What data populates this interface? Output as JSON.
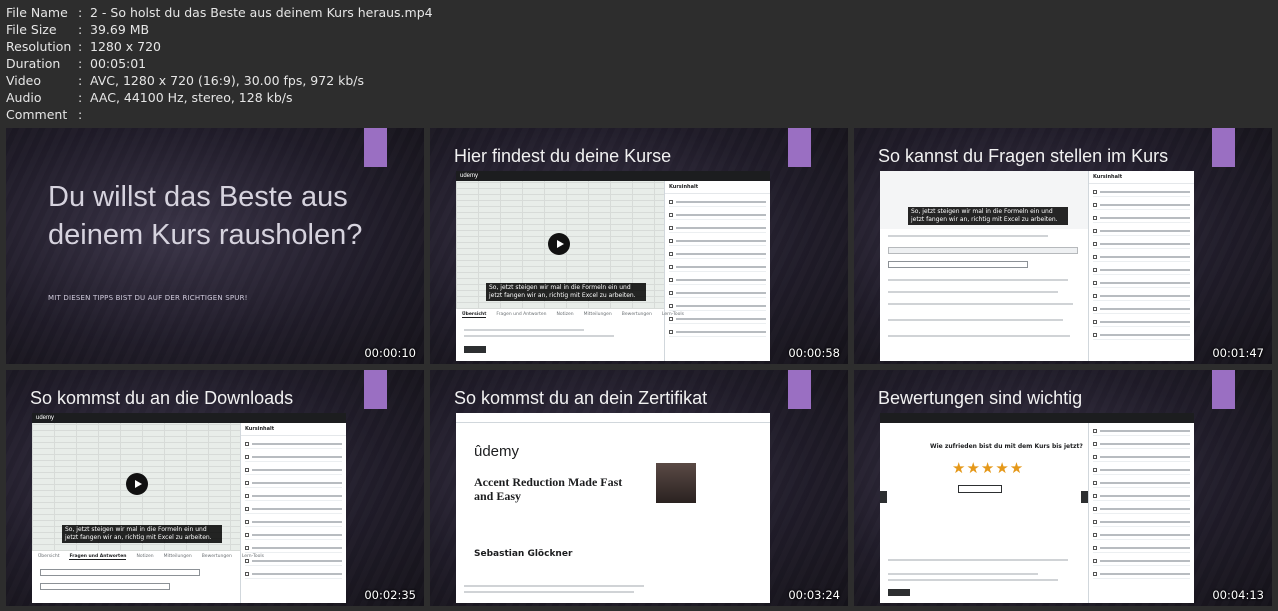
{
  "meta": {
    "rows": [
      {
        "key": "File Name",
        "value": "2 - So holst du das Beste aus deinem Kurs heraus.mp4"
      },
      {
        "key": "File Size",
        "value": "39.69 MB"
      },
      {
        "key": "Resolution",
        "value": "1280 x 720"
      },
      {
        "key": "Duration",
        "value": "00:05:01"
      },
      {
        "key": "Video",
        "value": "AVC, 1280 x 720 (16:9), 30.00 fps, 972 kb/s"
      },
      {
        "key": "Audio",
        "value": "AAC, 44100 Hz, stereo, 128 kb/s"
      },
      {
        "key": "Comment",
        "value": ""
      }
    ],
    "separator": ":"
  },
  "thumbs": [
    {
      "title": "",
      "big_text": "Du willst das Beste aus deinem Kurs rausholen?",
      "sub_text": "MIT DIESEN TIPPS BIST DU AUF DER RICHTIGEN SPUR!",
      "timestamp": "00:00:10"
    },
    {
      "title": "Hier findest du deine Kurse",
      "logo": "udemy",
      "caption": "So, jetzt steigen wir mal in die Formeln ein und jetzt fangen wir an, richtig mit Excel zu arbeiten.",
      "sidebar_head": "Kursinhalt",
      "tabs": [
        "Übersicht",
        "Fragen und Antworten",
        "Notizen",
        "Mitteilungen",
        "Bewertungen",
        "Lern-Tools"
      ],
      "timestamp": "00:00:58"
    },
    {
      "title": "So kannst du Fragen stellen im Kurs",
      "caption": "So, jetzt steigen wir mal in die Formeln ein und jetzt fangen wir an, richtig mit Excel zu arbeiten.",
      "sidebar_head": "Kursinhalt",
      "timestamp": "00:01:47"
    },
    {
      "title": "So kommst du an die Downloads",
      "logo": "udemy",
      "caption": "So, jetzt steigen wir mal in die Formeln ein und jetzt fangen wir an, richtig mit Excel zu arbeiten.",
      "sidebar_head": "Kursinhalt",
      "tabs": [
        "Übersicht",
        "Fragen und Antworten",
        "Notizen",
        "Mitteilungen",
        "Bewertungen",
        "Lern-Tools"
      ],
      "timestamp": "00:02:35"
    },
    {
      "title": "So kommst du an dein Zertifikat",
      "logo": "ûdemy",
      "cert_title": "Accent Reduction Made Fast and Easy",
      "cert_name": "Sebastian Glöckner",
      "timestamp": "00:03:24"
    },
    {
      "title": "Bewertungen sind wichtig",
      "rating_question": "Wie zufrieden bist du mit dem Kurs bis jetzt?",
      "stars": "★★★★★",
      "timestamp": "00:04:13"
    }
  ]
}
